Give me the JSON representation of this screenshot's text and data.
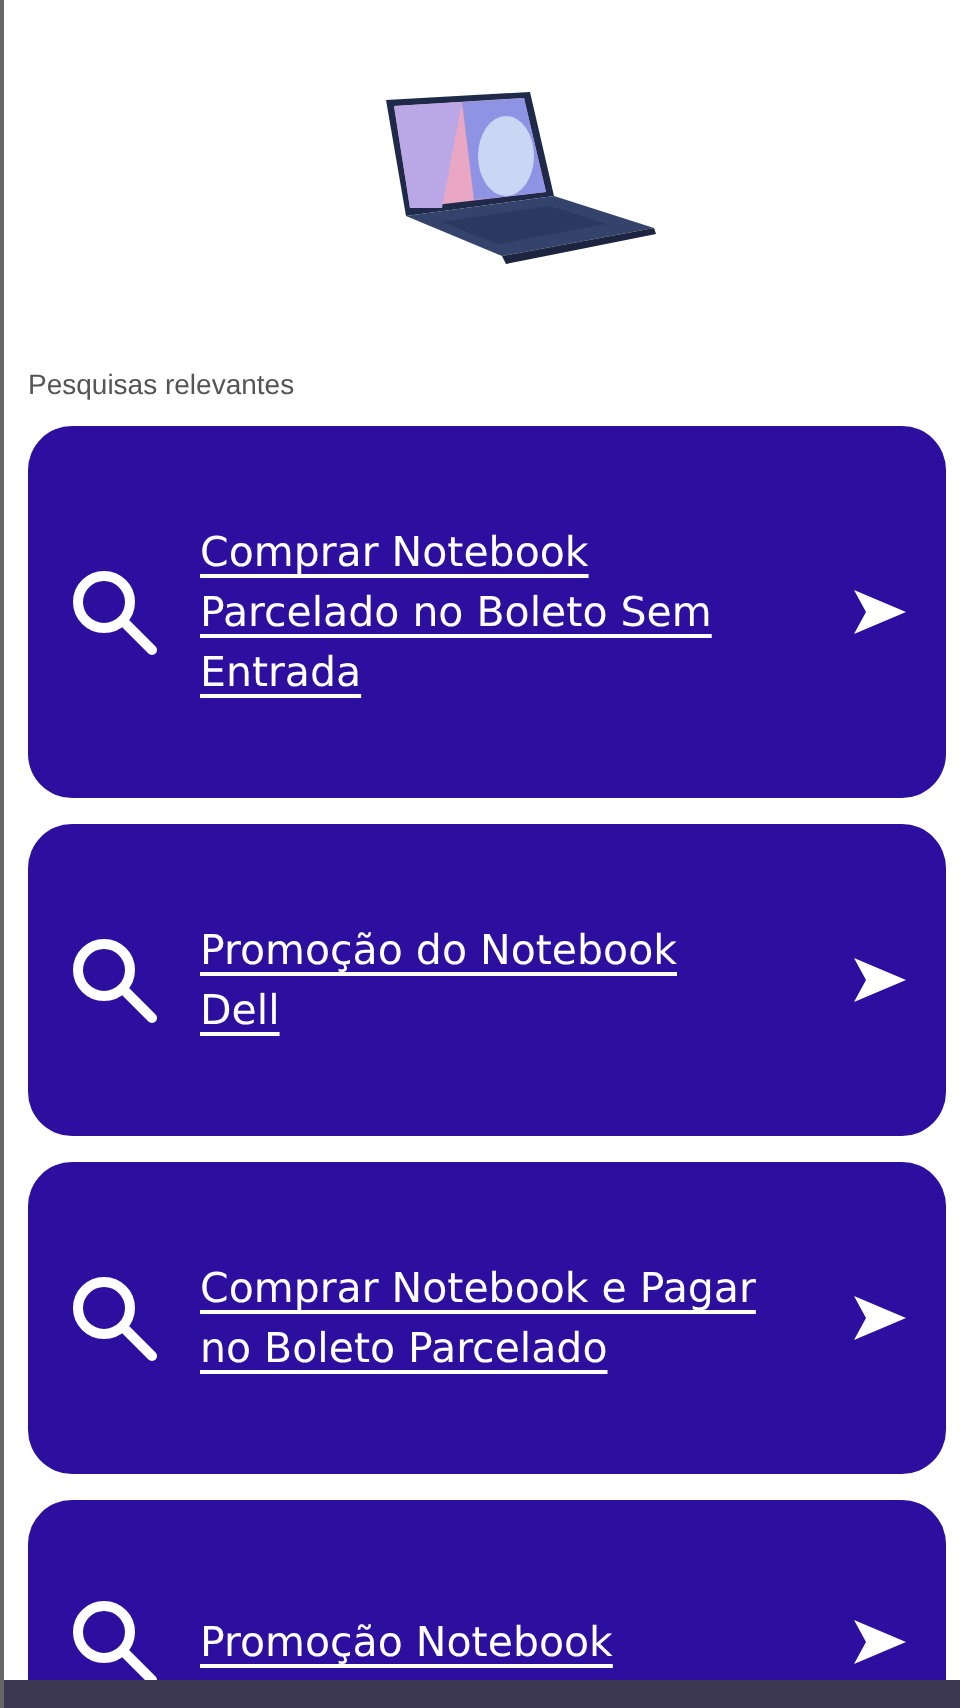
{
  "section_title": "Pesquisas relevantes",
  "searches": [
    {
      "text": "Comprar Notebook\nParcelado no Boleto Sem\nEntrada"
    },
    {
      "text": "Promoção do Notebook\nDell"
    },
    {
      "text": "Comprar Notebook e Pagar\nno Boleto Parcelado"
    },
    {
      "text": "Promoção Notebook"
    }
  ]
}
